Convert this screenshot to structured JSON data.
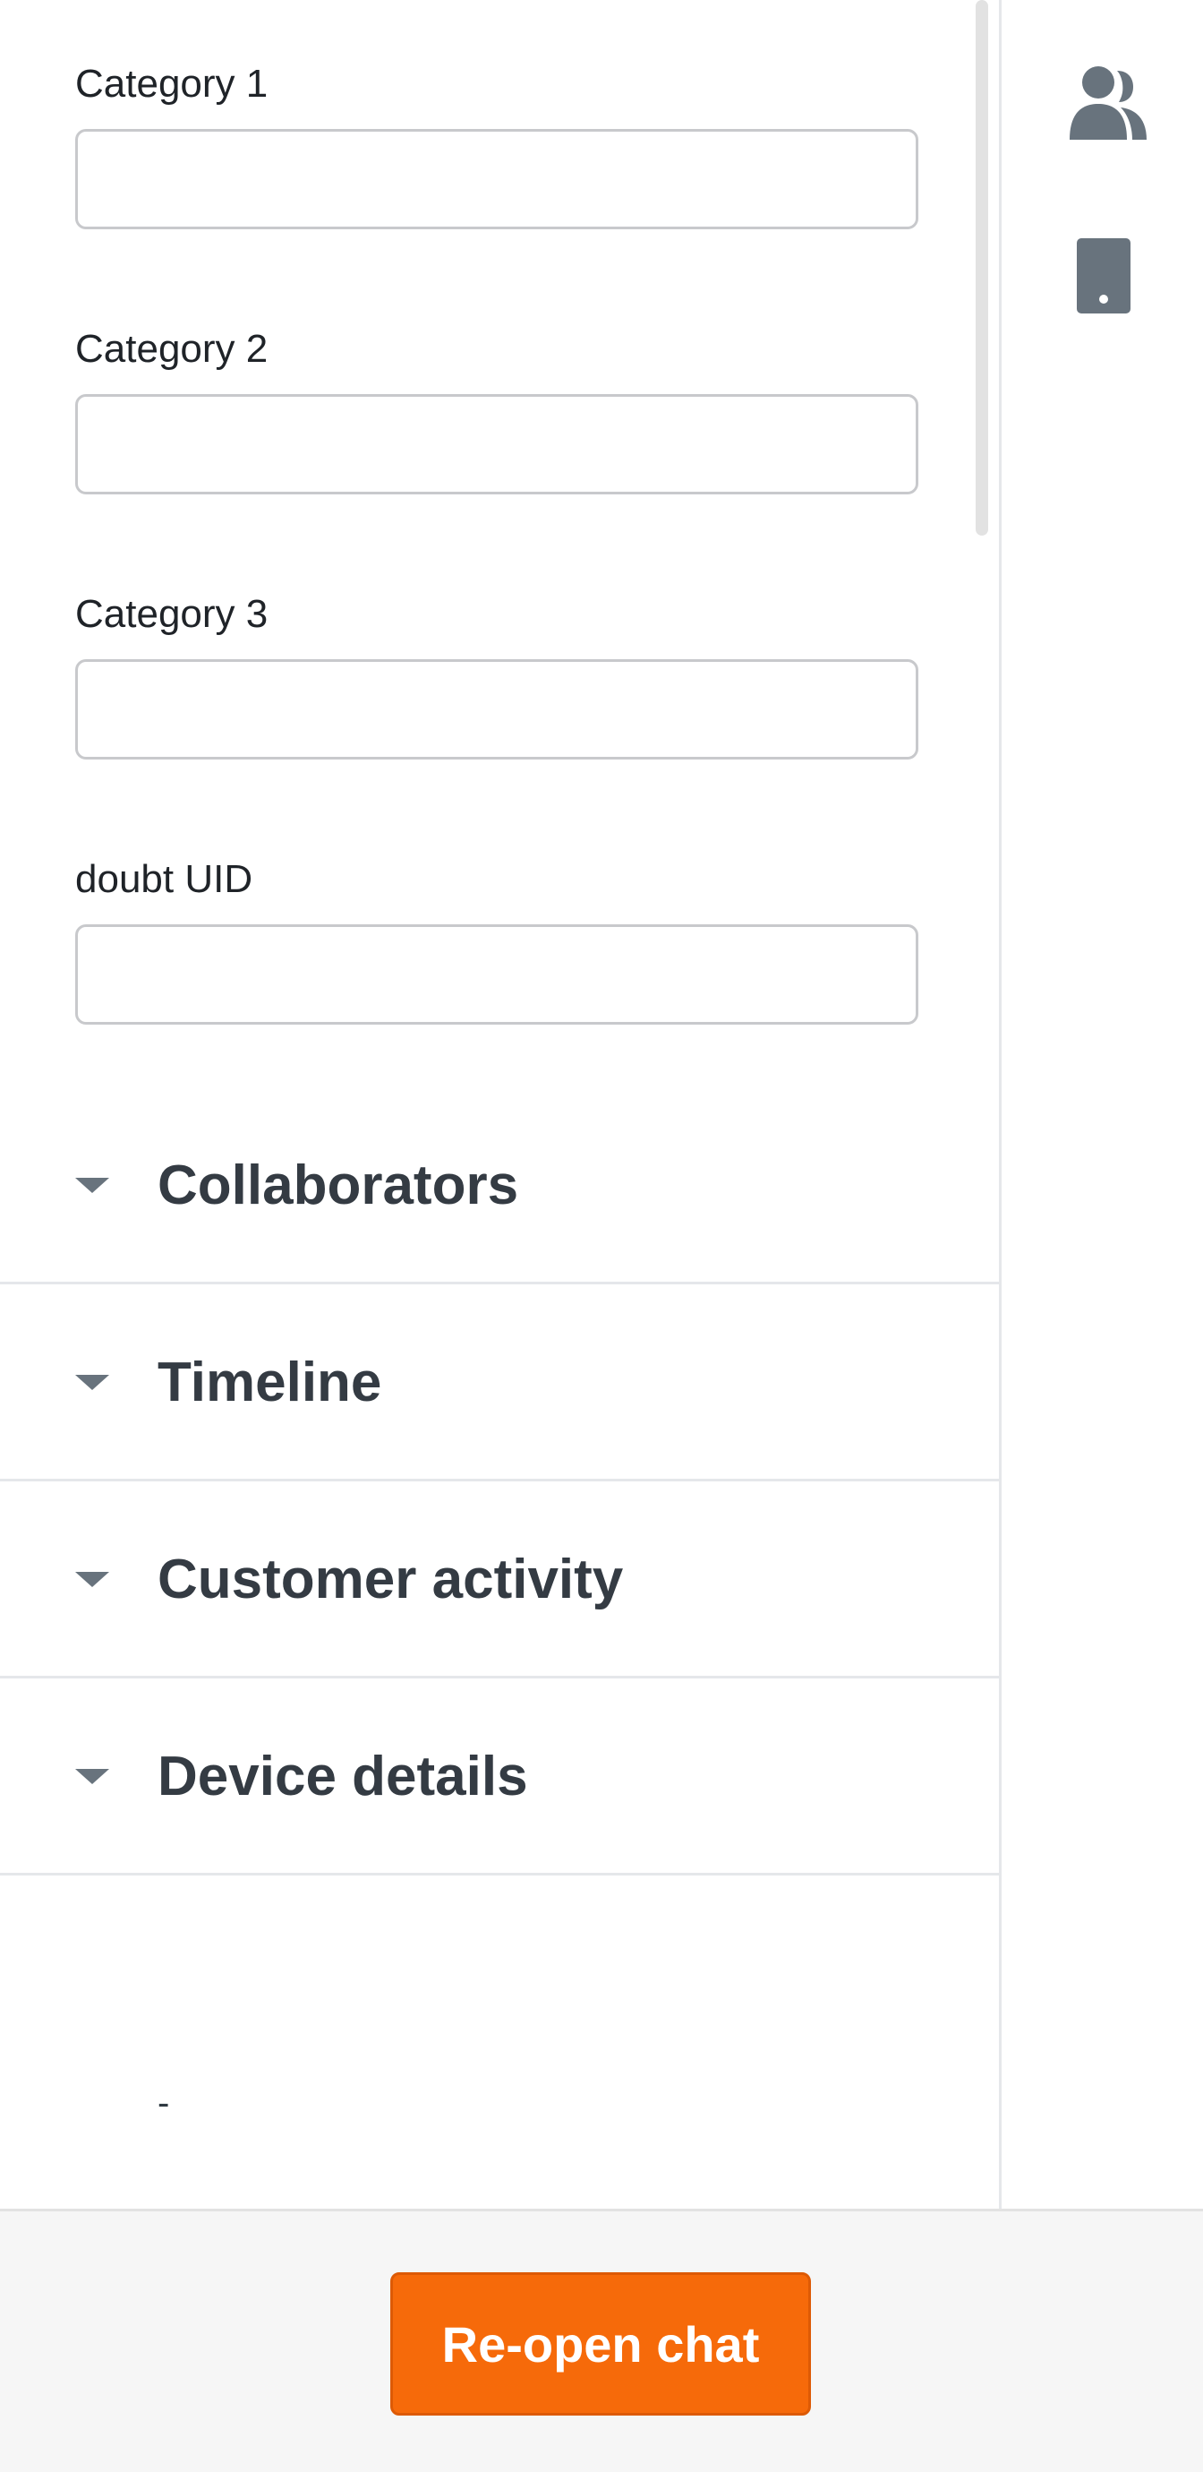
{
  "fields": [
    {
      "label": "Category 1",
      "value": "",
      "placeholder": ""
    },
    {
      "label": "Category 2",
      "value": "",
      "placeholder": ""
    },
    {
      "label": "Category 3",
      "value": "",
      "placeholder": ""
    },
    {
      "label": "doubt UID",
      "value": "",
      "placeholder": ""
    }
  ],
  "sections": [
    {
      "title": "Collaborators",
      "icon": "caret-down-icon"
    },
    {
      "title": "Timeline",
      "icon": "caret-down-icon"
    },
    {
      "title": "Customer activity",
      "icon": "caret-down-icon"
    },
    {
      "title": "Device details",
      "icon": "caret-down-icon"
    }
  ],
  "device_details_value": "-",
  "right_rail": {
    "icons": [
      "users-icon",
      "mobile-device-icon"
    ]
  },
  "footer": {
    "reopen_label": "Re-open chat"
  },
  "colors": {
    "accent": "#f66a0a",
    "icon_gray": "#68737d",
    "border": "#c8c9cc"
  }
}
